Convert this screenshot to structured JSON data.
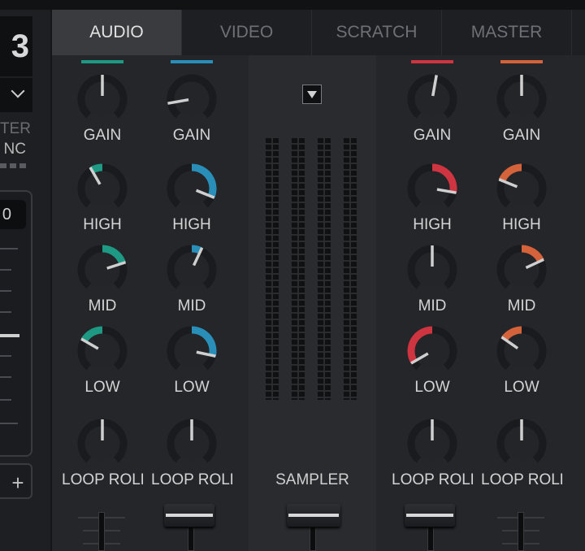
{
  "deck": {
    "number": "3",
    "master_label": "TER",
    "sync_label": "NC",
    "pitch_value": "0",
    "plus_label": "+"
  },
  "tabs": [
    {
      "label": "AUDIO",
      "active": true
    },
    {
      "label": "VIDEO",
      "active": false
    },
    {
      "label": "SCRATCH",
      "active": false
    },
    {
      "label": "MASTER",
      "active": false
    }
  ],
  "channels": [
    {
      "color": "#1e9a84",
      "gain": "GAIN",
      "high": "HIGH",
      "mid": "MID",
      "low": "LOW",
      "fx": "LOOP ROLL"
    },
    {
      "color": "#2a8fb8",
      "gain": "GAIN",
      "high": "HIGH",
      "mid": "MID",
      "low": "LOW",
      "fx": "LOOP ROLL"
    },
    {
      "color": "#cf3540",
      "gain": "GAIN",
      "high": "HIGH",
      "mid": "MID",
      "low": "LOW",
      "fx": "LOOP ROLL"
    },
    {
      "color": "#d4623a",
      "gain": "GAIN",
      "high": "HIGH",
      "mid": "MID",
      "low": "LOW",
      "fx": "LOOP ROLL"
    }
  ],
  "center": {
    "sampler_label": "SAMPLER"
  },
  "fx_label_visible": "OOP ROLL"
}
